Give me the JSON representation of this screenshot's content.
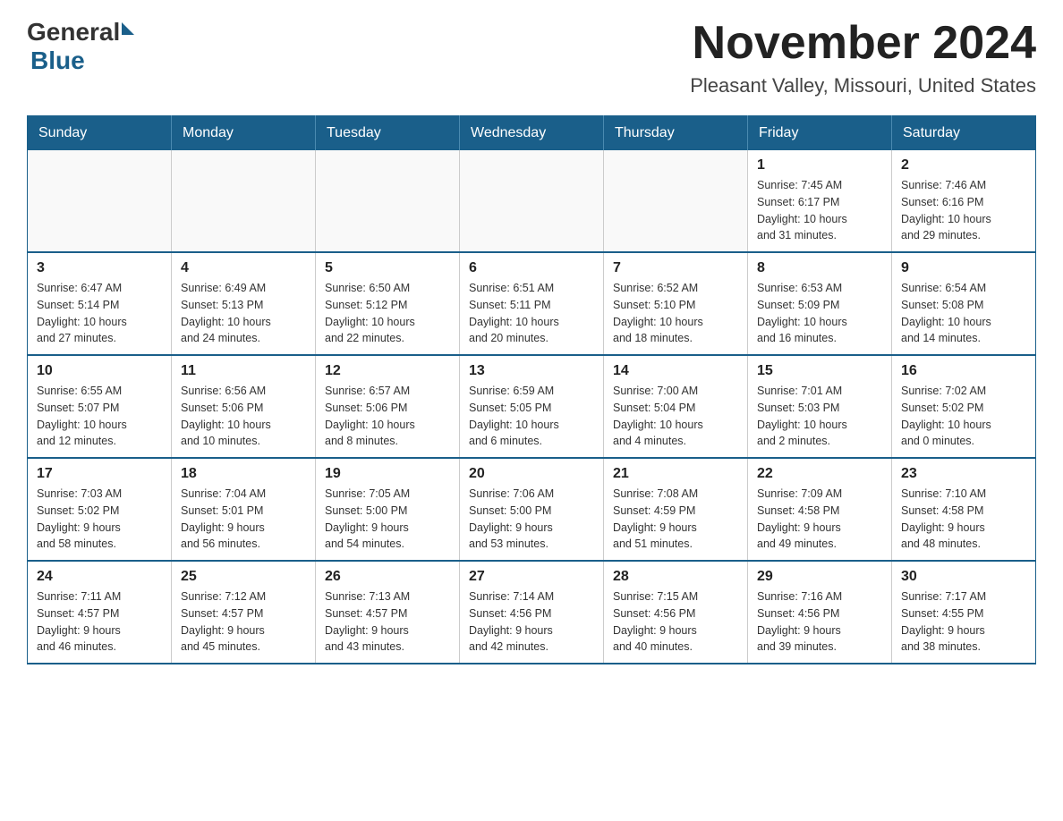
{
  "logo": {
    "general": "General",
    "blue": "Blue"
  },
  "header": {
    "month": "November 2024",
    "location": "Pleasant Valley, Missouri, United States"
  },
  "weekdays": [
    "Sunday",
    "Monday",
    "Tuesday",
    "Wednesday",
    "Thursday",
    "Friday",
    "Saturday"
  ],
  "weeks": [
    [
      {
        "day": "",
        "info": ""
      },
      {
        "day": "",
        "info": ""
      },
      {
        "day": "",
        "info": ""
      },
      {
        "day": "",
        "info": ""
      },
      {
        "day": "",
        "info": ""
      },
      {
        "day": "1",
        "info": "Sunrise: 7:45 AM\nSunset: 6:17 PM\nDaylight: 10 hours\nand 31 minutes."
      },
      {
        "day": "2",
        "info": "Sunrise: 7:46 AM\nSunset: 6:16 PM\nDaylight: 10 hours\nand 29 minutes."
      }
    ],
    [
      {
        "day": "3",
        "info": "Sunrise: 6:47 AM\nSunset: 5:14 PM\nDaylight: 10 hours\nand 27 minutes."
      },
      {
        "day": "4",
        "info": "Sunrise: 6:49 AM\nSunset: 5:13 PM\nDaylight: 10 hours\nand 24 minutes."
      },
      {
        "day": "5",
        "info": "Sunrise: 6:50 AM\nSunset: 5:12 PM\nDaylight: 10 hours\nand 22 minutes."
      },
      {
        "day": "6",
        "info": "Sunrise: 6:51 AM\nSunset: 5:11 PM\nDaylight: 10 hours\nand 20 minutes."
      },
      {
        "day": "7",
        "info": "Sunrise: 6:52 AM\nSunset: 5:10 PM\nDaylight: 10 hours\nand 18 minutes."
      },
      {
        "day": "8",
        "info": "Sunrise: 6:53 AM\nSunset: 5:09 PM\nDaylight: 10 hours\nand 16 minutes."
      },
      {
        "day": "9",
        "info": "Sunrise: 6:54 AM\nSunset: 5:08 PM\nDaylight: 10 hours\nand 14 minutes."
      }
    ],
    [
      {
        "day": "10",
        "info": "Sunrise: 6:55 AM\nSunset: 5:07 PM\nDaylight: 10 hours\nand 12 minutes."
      },
      {
        "day": "11",
        "info": "Sunrise: 6:56 AM\nSunset: 5:06 PM\nDaylight: 10 hours\nand 10 minutes."
      },
      {
        "day": "12",
        "info": "Sunrise: 6:57 AM\nSunset: 5:06 PM\nDaylight: 10 hours\nand 8 minutes."
      },
      {
        "day": "13",
        "info": "Sunrise: 6:59 AM\nSunset: 5:05 PM\nDaylight: 10 hours\nand 6 minutes."
      },
      {
        "day": "14",
        "info": "Sunrise: 7:00 AM\nSunset: 5:04 PM\nDaylight: 10 hours\nand 4 minutes."
      },
      {
        "day": "15",
        "info": "Sunrise: 7:01 AM\nSunset: 5:03 PM\nDaylight: 10 hours\nand 2 minutes."
      },
      {
        "day": "16",
        "info": "Sunrise: 7:02 AM\nSunset: 5:02 PM\nDaylight: 10 hours\nand 0 minutes."
      }
    ],
    [
      {
        "day": "17",
        "info": "Sunrise: 7:03 AM\nSunset: 5:02 PM\nDaylight: 9 hours\nand 58 minutes."
      },
      {
        "day": "18",
        "info": "Sunrise: 7:04 AM\nSunset: 5:01 PM\nDaylight: 9 hours\nand 56 minutes."
      },
      {
        "day": "19",
        "info": "Sunrise: 7:05 AM\nSunset: 5:00 PM\nDaylight: 9 hours\nand 54 minutes."
      },
      {
        "day": "20",
        "info": "Sunrise: 7:06 AM\nSunset: 5:00 PM\nDaylight: 9 hours\nand 53 minutes."
      },
      {
        "day": "21",
        "info": "Sunrise: 7:08 AM\nSunset: 4:59 PM\nDaylight: 9 hours\nand 51 minutes."
      },
      {
        "day": "22",
        "info": "Sunrise: 7:09 AM\nSunset: 4:58 PM\nDaylight: 9 hours\nand 49 minutes."
      },
      {
        "day": "23",
        "info": "Sunrise: 7:10 AM\nSunset: 4:58 PM\nDaylight: 9 hours\nand 48 minutes."
      }
    ],
    [
      {
        "day": "24",
        "info": "Sunrise: 7:11 AM\nSunset: 4:57 PM\nDaylight: 9 hours\nand 46 minutes."
      },
      {
        "day": "25",
        "info": "Sunrise: 7:12 AM\nSunset: 4:57 PM\nDaylight: 9 hours\nand 45 minutes."
      },
      {
        "day": "26",
        "info": "Sunrise: 7:13 AM\nSunset: 4:57 PM\nDaylight: 9 hours\nand 43 minutes."
      },
      {
        "day": "27",
        "info": "Sunrise: 7:14 AM\nSunset: 4:56 PM\nDaylight: 9 hours\nand 42 minutes."
      },
      {
        "day": "28",
        "info": "Sunrise: 7:15 AM\nSunset: 4:56 PM\nDaylight: 9 hours\nand 40 minutes."
      },
      {
        "day": "29",
        "info": "Sunrise: 7:16 AM\nSunset: 4:56 PM\nDaylight: 9 hours\nand 39 minutes."
      },
      {
        "day": "30",
        "info": "Sunrise: 7:17 AM\nSunset: 4:55 PM\nDaylight: 9 hours\nand 38 minutes."
      }
    ]
  ]
}
